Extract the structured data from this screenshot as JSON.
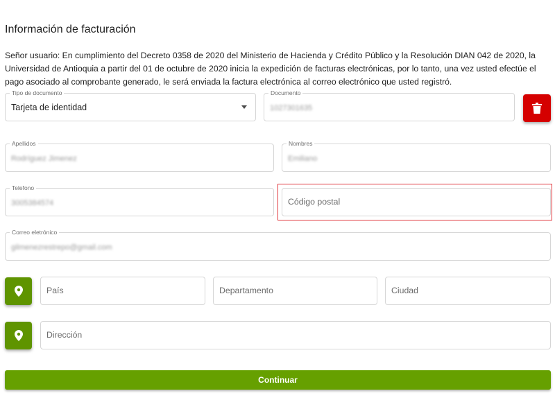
{
  "header": {
    "title": "Información de facturación"
  },
  "notice": "Señor usuario: En cumplimiento del Decreto 0358 de 2020 del Ministerio de Hacienda y Crédito Público y la Resolución DIAN 042 de 2020, la Universidad de Antioquia a partir del 01 de octubre de 2020 inicia la expedición de facturas electrónicas, por lo tanto, una vez usted efectúe el pago asociado al comprobante generado, le será enviada la factura electrónica al correo electrónico que usted registró.",
  "form": {
    "tipo_documento": {
      "label": "Tipo de documento",
      "value": "Tarjeta de identidad"
    },
    "documento": {
      "label": "Documento",
      "value": "1027301635"
    },
    "apellidos": {
      "label": "Apellidos",
      "value": "Rodríguez Jimenez"
    },
    "nombres": {
      "label": "Nombres",
      "value": "Emiliano"
    },
    "telefono": {
      "label": "Telefono",
      "value": "3005384574"
    },
    "codigo_postal": {
      "placeholder": "Código postal"
    },
    "correo": {
      "label": "Correo eletrónico",
      "value": "gilmenezrestrepo@gmail.com"
    },
    "pais": {
      "placeholder": "País"
    },
    "departamento": {
      "placeholder": "Departamento"
    },
    "ciudad": {
      "placeholder": "Ciudad"
    },
    "direccion": {
      "placeholder": "Dirección"
    }
  },
  "actions": {
    "continue_label": "Continuar"
  },
  "icons": {
    "delete": "trash-icon",
    "location": "location-pin-icon"
  },
  "colors": {
    "primary_green": "#66a000",
    "location_green": "#5f9400",
    "danger_red": "#d50000",
    "highlight_red": "#e0383e"
  }
}
